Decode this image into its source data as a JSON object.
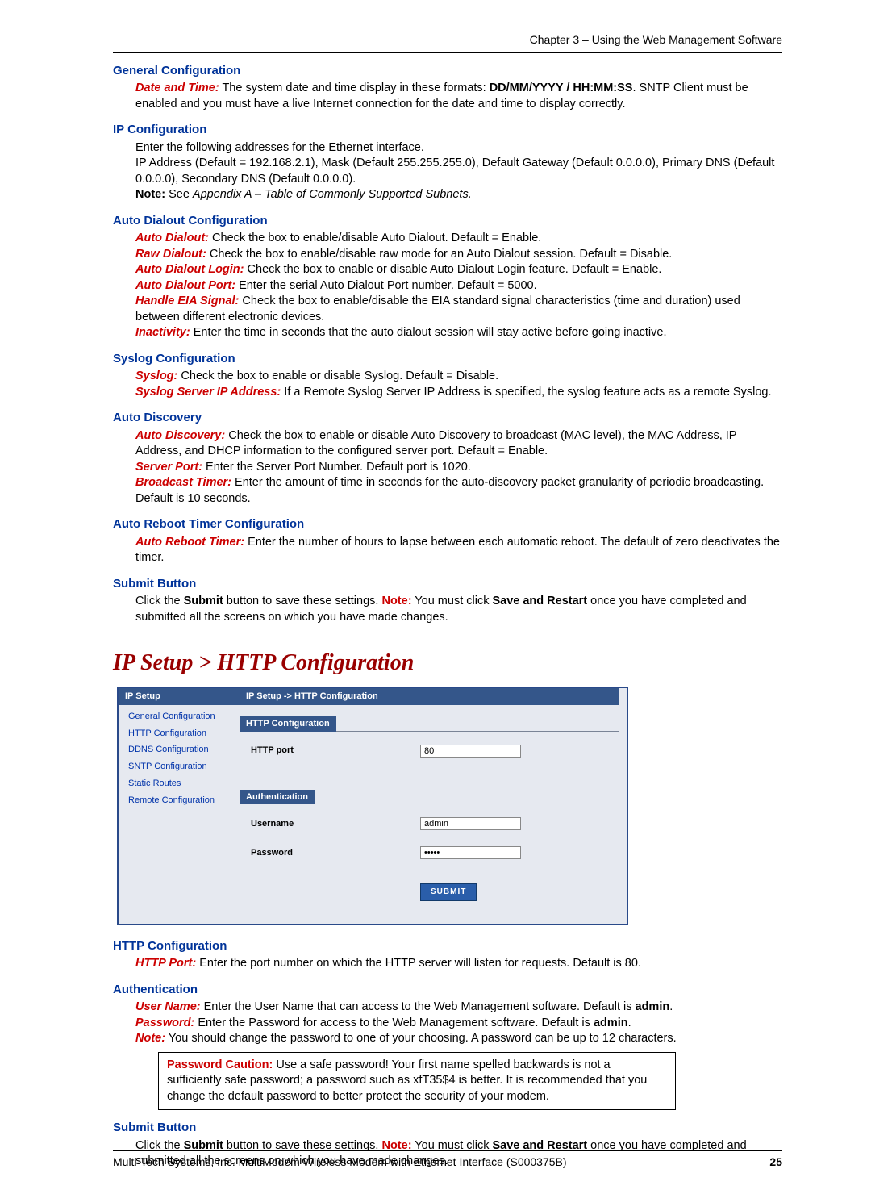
{
  "header": {
    "chapter": "Chapter 3 – Using the Web Management Software"
  },
  "sections": {
    "genconf": {
      "title": "General Configuration",
      "datetime_term": "Date and Time:",
      "datetime_text_a": " The system date and time display in these formats: ",
      "datetime_fmt": "DD/MM/YYYY / HH:MM:SS",
      "datetime_text_b": ". SNTP Client must be enabled and you must have a live Internet connection for the date and time to display correctly."
    },
    "ipconf": {
      "title": "IP Configuration",
      "p1": "Enter the following addresses for the Ethernet interface.",
      "p2": "IP Address (Default = 192.168.2.1), Mask (Default 255.255.255.0), Default Gateway (Default 0.0.0.0), Primary DNS (Default 0.0.0.0), Secondary DNS (Default 0.0.0.0).",
      "note_label": "Note:",
      "note_text": " See ",
      "note_italic": "Appendix A – Table of Commonly Supported Subnets."
    },
    "autodial": {
      "title": "Auto Dialout Configuration",
      "r1_term": "Auto Dialout:",
      "r1_text": " Check the box to enable/disable Auto Dialout. Default = Enable.",
      "r2_term": "Raw Dialout:",
      "r2_text": " Check the box to enable/disable raw mode for an Auto Dialout session. Default = Disable.",
      "r3_term": "Auto Dialout Login:",
      "r3_text": " Check the box to enable or disable Auto Dialout Login feature. Default = Enable.",
      "r4_term": "Auto Dialout Port:",
      "r4_text": " Enter the serial Auto Dialout Port number. Default = 5000.",
      "r5_term": "Handle EIA Signal:",
      "r5_text": "  Check the box to enable/disable the EIA standard signal characteristics (time and duration) used between different electronic devices.",
      "r6_term": "Inactivity:",
      "r6_text": "   Enter the time in seconds that the auto dialout session will stay active before going inactive."
    },
    "syslog": {
      "title": "Syslog Configuration",
      "r1_term": "Syslog:",
      "r1_text": "  Check the box to enable or disable Syslog. Default = Disable.",
      "r2_term": "Syslog Server IP Address:",
      "r2_text": " If a Remote Syslog Server IP Address is specified, the syslog feature acts as a remote Syslog."
    },
    "autodisc": {
      "title": "Auto Discovery",
      "r1_term": "Auto Discovery:",
      "r1_text": " Check the box to enable or disable Auto Discovery to broadcast (MAC level), the MAC Address, IP Address, and DHCP information to the configured server port.  Default = Enable.",
      "r2_term": "Server Port:",
      "r2_text": " Enter the Server Port Number. Default port is 1020.",
      "r3_term": "Broadcast Timer:",
      "r3_text": " Enter the amount of time in seconds for the auto-discovery packet granularity of periodic broadcasting. Default is 10 seconds."
    },
    "reboot": {
      "title": "Auto Reboot Timer Configuration",
      "r1_term": "Auto Reboot Timer:",
      "r1_text": " Enter the number of hours to lapse between each automatic reboot. The default of zero deactivates the timer."
    },
    "submit1": {
      "title": "Submit Button",
      "text_a": "Click the ",
      "b1": "Submit",
      "text_b": " button to save these settings. ",
      "note": "Note:",
      "text_c": " You must click ",
      "b2": "Save and Restart",
      "text_d": " once you have completed and submitted all the screens on which you have made changes."
    },
    "bigtitle": "IP Setup > HTTP Configuration",
    "shot": {
      "nav_header": "IP Setup",
      "nav_items": [
        "General Configuration",
        "HTTP Configuration",
        "DDNS Configuration",
        "SNTP Configuration",
        "Static Routes",
        "Remote Configuration"
      ],
      "crumb": "IP Setup  ->  HTTP Configuration",
      "group1": "HTTP Configuration",
      "http_port_label": "HTTP port",
      "http_port_value": "80",
      "group2": "Authentication",
      "username_label": "Username",
      "username_value": "admin",
      "password_label": "Password",
      "password_value": "•••••",
      "submit_label": "SUBMIT"
    },
    "httpconf": {
      "title": "HTTP Configuration",
      "r1_term": "HTTP Port:",
      "r1_text": " Enter the port number on which the HTTP server will listen for requests. Default is 80."
    },
    "auth": {
      "title": "Authentication",
      "r1_term": "User Name:",
      "r1_text": " Enter the User Name that can access to the Web Management software. Default is ",
      "r1_bold": "admin",
      "r1_dot": ".",
      "r2_term": "Password:",
      "r2_text": " Enter the Password for access to the Web Management software. Default is ",
      "r2_bold": "admin",
      "r2_dot": ".",
      "r3_term": "Note:",
      "r3_text": " You should change the password to one of your choosing. A password can be up to 12 characters."
    },
    "caution": {
      "title": "Password Caution:",
      "text": " Use a safe password! Your first name spelled backwards is not a sufficiently safe password; a password such as xfT35$4 is better. It is recommended that you change the default password to better protect the security of your modem."
    },
    "submit2": {
      "title": "Submit Button",
      "text_a": "Click the ",
      "b1": "Submit",
      "text_b": " button to save these settings. ",
      "note": "Note:",
      "text_c": " You must click ",
      "b2": "Save and Restart",
      "text_d": " once you have completed and submitted all the screens on which you have made changes."
    }
  },
  "footer": {
    "text": "Multi-Tech Systems, Inc. MultiModem Wireless Modem with Ethernet Interface (S000375B)",
    "page": "25"
  }
}
